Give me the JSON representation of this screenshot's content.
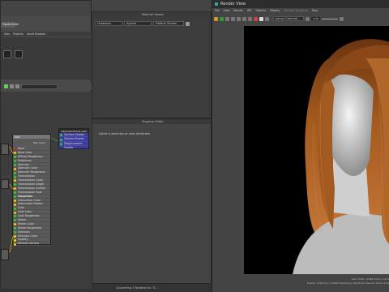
{
  "left_panel": {
    "tabs": [
      "Hypershade"
    ],
    "browser_tabs": [
      "Sets",
      "Projects",
      "Asset Browser"
    ],
    "search_placeholder": ""
  },
  "node_editor": {
    "nodes": [
      {
        "title": "hair",
        "subtitle": "Hair Color",
        "attributes": [
          {
            "label": "Base",
            "color": "#cc3333"
          },
          {
            "label": "Base Color",
            "color": "#ffcc00"
          },
          {
            "label": "Diffuse Roughness",
            "color": "#33cc33"
          },
          {
            "label": "Metalness",
            "color": "#33cc33"
          },
          {
            "label": "Specular",
            "color": "#33cc33"
          },
          {
            "label": "Specular Color",
            "color": "#ffcc00"
          },
          {
            "label": "Specular Roughness",
            "color": "#33cc33"
          },
          {
            "label": "Transmission",
            "color": "#33cc33"
          },
          {
            "label": "Transmission Color",
            "color": "#ffcc00"
          },
          {
            "label": "Transmission Depth",
            "color": "#33cc33"
          },
          {
            "label": "Transmission Scatter",
            "color": "#ffcc00"
          },
          {
            "label": "Transmission Scat Roughness",
            "color": "#33cc33"
          },
          {
            "label": "Subsurface",
            "color": "#33cc33"
          },
          {
            "label": "Subsurface Color",
            "color": "#ffcc00"
          },
          {
            "label": "Subsurface Radius",
            "color": "#ffcc00"
          },
          {
            "label": "Coat",
            "color": "#33cc33"
          },
          {
            "label": "Coat Color",
            "color": "#ffcc00"
          },
          {
            "label": "Coat Roughness",
            "color": "#33cc33"
          },
          {
            "label": "Sheen",
            "color": "#33cc33"
          },
          {
            "label": "Sheen Color",
            "color": "#ffcc00"
          },
          {
            "label": "Sheen Roughness",
            "color": "#33cc33"
          },
          {
            "label": "Emission",
            "color": "#33cc33"
          },
          {
            "label": "Emission Color",
            "color": "#ffcc00"
          },
          {
            "label": "Opacity",
            "color": "#ffcc00"
          },
          {
            "label": "Normal Camera",
            "color": "#ffcc00"
          }
        ]
      },
      {
        "title": "aiStandardSurfaceSG",
        "attributes": [
          {
            "label": "Surface Shader",
            "color": "#33cc33"
          },
          {
            "label": "Volume Shader",
            "color": "#33cc33"
          },
          {
            "label": "Displacement Shader",
            "color": "#33cc33"
          }
        ]
      }
    ]
  },
  "center_panel": {
    "header_title": "Material Viewer",
    "dropdowns": [
      "Hardware",
      "Sphere",
      "Default Shader"
    ],
    "property_title": "Property Editor",
    "property_message": "Select a selection to view attributes."
  },
  "status_bar": {
    "text": "Converting 4 Nodeset to: TC..."
  },
  "render_view": {
    "title": "Render View",
    "menu": [
      "File",
      "View",
      "Render",
      "IPR",
      "Options",
      "Display",
      "Window Snapshot",
      "Help"
    ],
    "camera_dropdown": "persp (Camera)",
    "zoom_value": "0.00",
    "info_line1": "size: 2048 x 2048  zoom: 0.474",
    "info_line2": "Frame: 1  Memory: 12345b  Sampling: [6/2/2/2/2]  Render Time: 0:41"
  },
  "colors": {
    "render_bg": "#000000",
    "hair_base": "#a55a1e",
    "node_header": "#777777",
    "sg_node_header": "#3b3b9a"
  }
}
